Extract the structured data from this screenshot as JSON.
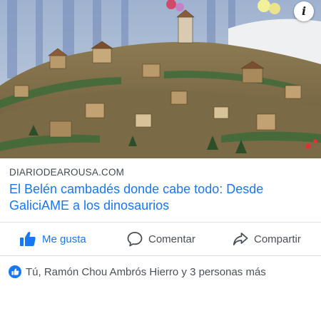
{
  "post": {
    "info_glyph": "i",
    "link": {
      "domain": "DIARIODEAROUSA.COM",
      "headline": "El Belén cambadés donde cabe todo: Desde GaliciAME a los dinosaurios"
    },
    "actions": {
      "like_label": "Me gusta",
      "comment_label": "Comentar",
      "share_label": "Compartir"
    },
    "reactions": {
      "summary": "Tú, Ramón Chou Ambrós Hierro y 3 personas más"
    }
  },
  "colors": {
    "accent": "#1877f2",
    "text_secondary": "#4b4f56",
    "divider": "#dddfe2"
  },
  "icons": {
    "like": "thumbs-up-icon",
    "comment": "speech-bubble-icon",
    "share": "share-arrow-icon",
    "info": "info-icon"
  }
}
